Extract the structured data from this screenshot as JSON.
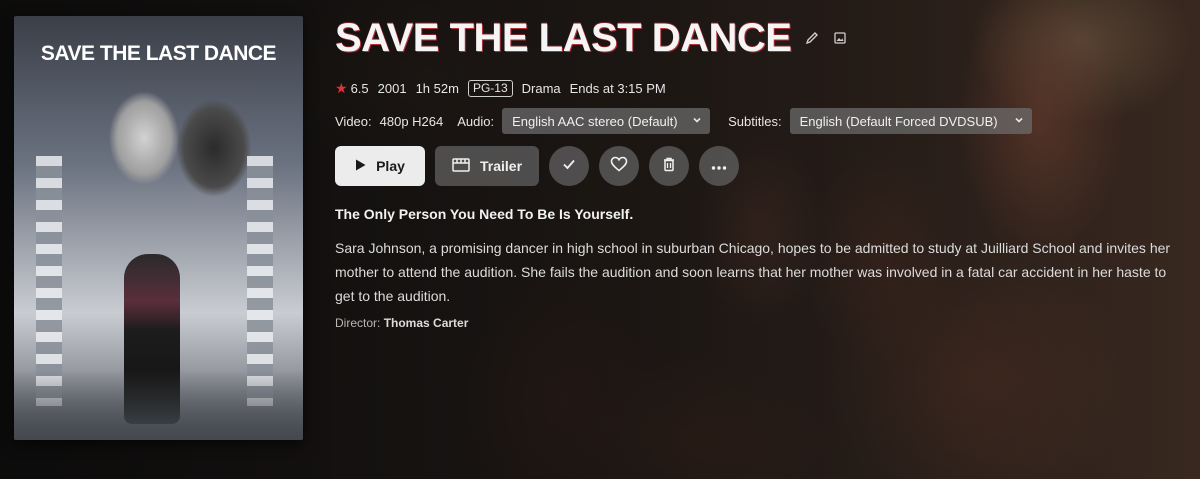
{
  "poster": {
    "title_text": "SAVE THE LAST DANCE"
  },
  "title": "SAVE THE LAST DANCE",
  "title_icons": [
    "edit-icon",
    "image-icon"
  ],
  "meta": {
    "rating": "6.5",
    "year": "2001",
    "runtime": "1h 52m",
    "content_rating": "PG-13",
    "genre": "Drama",
    "ends_at": "Ends at 3:15 PM"
  },
  "media": {
    "video_label": "Video:",
    "video_value": "480p H264",
    "audio_label": "Audio:",
    "audio_value": "English AAC stereo (Default)",
    "subtitles_label": "Subtitles:",
    "subtitles_value": "English (Default Forced DVDSUB)"
  },
  "buttons": {
    "play": "Play",
    "trailer": "Trailer",
    "icons": [
      "check-icon",
      "heart-icon",
      "trash-icon",
      "more-icon"
    ]
  },
  "tagline": "The Only Person You Need To Be Is Yourself.",
  "overview": "Sara Johnson, a promising dancer in high school in suburban Chicago, hopes to be admitted to study at Juilliard School and invites her mother to attend the audition. She fails the audition and soon learns that her mother was involved in a fatal car accident in her haste to get to the audition.",
  "director": {
    "label": "Director:",
    "name": "Thomas Carter"
  },
  "colors": {
    "accent_star": "#e0303a",
    "play_bg": "#ececec",
    "button_bg": "#646464"
  }
}
